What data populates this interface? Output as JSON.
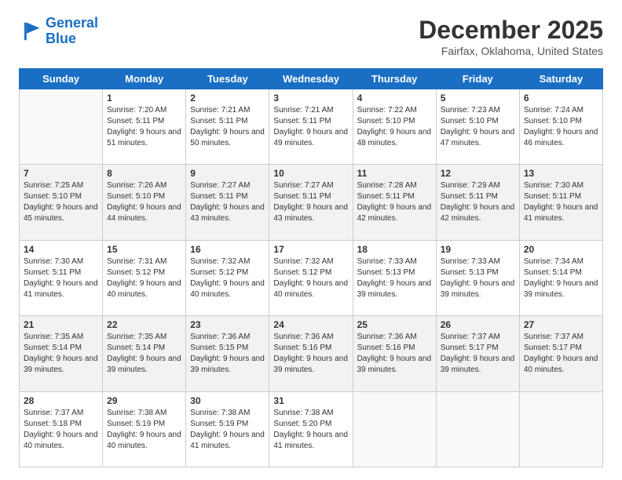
{
  "logo": {
    "line1": "General",
    "line2": "Blue"
  },
  "title": "December 2025",
  "location": "Fairfax, Oklahoma, United States",
  "days_of_week": [
    "Sunday",
    "Monday",
    "Tuesday",
    "Wednesday",
    "Thursday",
    "Friday",
    "Saturday"
  ],
  "weeks": [
    [
      {
        "day": "",
        "empty": true
      },
      {
        "day": "1",
        "sunrise": "7:20 AM",
        "sunset": "5:11 PM",
        "daylight": "9 hours and 51 minutes."
      },
      {
        "day": "2",
        "sunrise": "7:21 AM",
        "sunset": "5:11 PM",
        "daylight": "9 hours and 50 minutes."
      },
      {
        "day": "3",
        "sunrise": "7:21 AM",
        "sunset": "5:11 PM",
        "daylight": "9 hours and 49 minutes."
      },
      {
        "day": "4",
        "sunrise": "7:22 AM",
        "sunset": "5:10 PM",
        "daylight": "9 hours and 48 minutes."
      },
      {
        "day": "5",
        "sunrise": "7:23 AM",
        "sunset": "5:10 PM",
        "daylight": "9 hours and 47 minutes."
      },
      {
        "day": "6",
        "sunrise": "7:24 AM",
        "sunset": "5:10 PM",
        "daylight": "9 hours and 46 minutes."
      }
    ],
    [
      {
        "day": "7",
        "sunrise": "7:25 AM",
        "sunset": "5:10 PM",
        "daylight": "9 hours and 45 minutes."
      },
      {
        "day": "8",
        "sunrise": "7:26 AM",
        "sunset": "5:10 PM",
        "daylight": "9 hours and 44 minutes."
      },
      {
        "day": "9",
        "sunrise": "7:27 AM",
        "sunset": "5:11 PM",
        "daylight": "9 hours and 43 minutes."
      },
      {
        "day": "10",
        "sunrise": "7:27 AM",
        "sunset": "5:11 PM",
        "daylight": "9 hours and 43 minutes."
      },
      {
        "day": "11",
        "sunrise": "7:28 AM",
        "sunset": "5:11 PM",
        "daylight": "9 hours and 42 minutes."
      },
      {
        "day": "12",
        "sunrise": "7:29 AM",
        "sunset": "5:11 PM",
        "daylight": "9 hours and 42 minutes."
      },
      {
        "day": "13",
        "sunrise": "7:30 AM",
        "sunset": "5:11 PM",
        "daylight": "9 hours and 41 minutes."
      }
    ],
    [
      {
        "day": "14",
        "sunrise": "7:30 AM",
        "sunset": "5:11 PM",
        "daylight": "9 hours and 41 minutes."
      },
      {
        "day": "15",
        "sunrise": "7:31 AM",
        "sunset": "5:12 PM",
        "daylight": "9 hours and 40 minutes."
      },
      {
        "day": "16",
        "sunrise": "7:32 AM",
        "sunset": "5:12 PM",
        "daylight": "9 hours and 40 minutes."
      },
      {
        "day": "17",
        "sunrise": "7:32 AM",
        "sunset": "5:12 PM",
        "daylight": "9 hours and 40 minutes."
      },
      {
        "day": "18",
        "sunrise": "7:33 AM",
        "sunset": "5:13 PM",
        "daylight": "9 hours and 39 minutes."
      },
      {
        "day": "19",
        "sunrise": "7:33 AM",
        "sunset": "5:13 PM",
        "daylight": "9 hours and 39 minutes."
      },
      {
        "day": "20",
        "sunrise": "7:34 AM",
        "sunset": "5:14 PM",
        "daylight": "9 hours and 39 minutes."
      }
    ],
    [
      {
        "day": "21",
        "sunrise": "7:35 AM",
        "sunset": "5:14 PM",
        "daylight": "9 hours and 39 minutes."
      },
      {
        "day": "22",
        "sunrise": "7:35 AM",
        "sunset": "5:14 PM",
        "daylight": "9 hours and 39 minutes."
      },
      {
        "day": "23",
        "sunrise": "7:36 AM",
        "sunset": "5:15 PM",
        "daylight": "9 hours and 39 minutes."
      },
      {
        "day": "24",
        "sunrise": "7:36 AM",
        "sunset": "5:16 PM",
        "daylight": "9 hours and 39 minutes."
      },
      {
        "day": "25",
        "sunrise": "7:36 AM",
        "sunset": "5:16 PM",
        "daylight": "9 hours and 39 minutes."
      },
      {
        "day": "26",
        "sunrise": "7:37 AM",
        "sunset": "5:17 PM",
        "daylight": "9 hours and 39 minutes."
      },
      {
        "day": "27",
        "sunrise": "7:37 AM",
        "sunset": "5:17 PM",
        "daylight": "9 hours and 40 minutes."
      }
    ],
    [
      {
        "day": "28",
        "sunrise": "7:37 AM",
        "sunset": "5:18 PM",
        "daylight": "9 hours and 40 minutes."
      },
      {
        "day": "29",
        "sunrise": "7:38 AM",
        "sunset": "5:19 PM",
        "daylight": "9 hours and 40 minutes."
      },
      {
        "day": "30",
        "sunrise": "7:38 AM",
        "sunset": "5:19 PM",
        "daylight": "9 hours and 41 minutes."
      },
      {
        "day": "31",
        "sunrise": "7:38 AM",
        "sunset": "5:20 PM",
        "daylight": "9 hours and 41 minutes."
      },
      {
        "day": "",
        "empty": true
      },
      {
        "day": "",
        "empty": true
      },
      {
        "day": "",
        "empty": true
      }
    ]
  ]
}
